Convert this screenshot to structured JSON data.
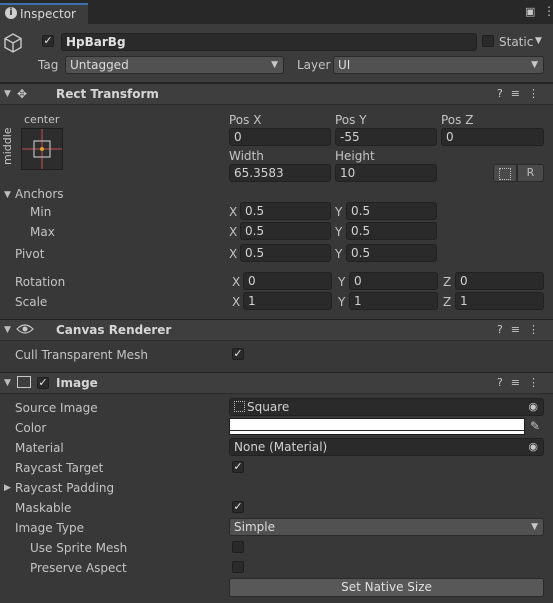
{
  "tab": {
    "title": "Inspector"
  },
  "object": {
    "name": "HpBarBg",
    "static_label": "Static",
    "tag_label": "Tag",
    "tag_value": "Untagged",
    "layer_label": "Layer",
    "layer_value": "UI"
  },
  "rect_transform": {
    "title": "Rect Transform",
    "anchor_preset_top": "center",
    "anchor_preset_side": "middle",
    "posx_label": "Pos X",
    "posy_label": "Pos Y",
    "posz_label": "Pos Z",
    "posx": "0",
    "posy": "-55",
    "posz": "0",
    "width_label": "Width",
    "height_label": "Height",
    "width": "65.3583",
    "height": "10",
    "r_button": "R",
    "anchors_label": "Anchors",
    "min_label": "Min",
    "max_label": "Max",
    "min_x": "0.5",
    "min_y": "0.5",
    "max_x": "0.5",
    "max_y": "0.5",
    "pivot_label": "Pivot",
    "pivot_x": "0.5",
    "pivot_y": "0.5",
    "rotation_label": "Rotation",
    "rot_x": "0",
    "rot_y": "0",
    "rot_z": "0",
    "scale_label": "Scale",
    "scale_x": "1",
    "scale_y": "1",
    "scale_z": "1",
    "x": "X",
    "y": "Y",
    "z": "Z"
  },
  "canvas_renderer": {
    "title": "Canvas Renderer",
    "cull_label": "Cull Transparent Mesh"
  },
  "image": {
    "title": "Image",
    "source_label": "Source Image",
    "source_value": "Square",
    "color_label": "Color",
    "material_label": "Material",
    "material_value": "None (Material)",
    "raycast_target_label": "Raycast Target",
    "raycast_padding_label": "Raycast Padding",
    "maskable_label": "Maskable",
    "image_type_label": "Image Type",
    "image_type_value": "Simple",
    "use_sprite_mesh_label": "Use Sprite Mesh",
    "preserve_aspect_label": "Preserve Aspect",
    "native_size_button": "Set Native Size"
  }
}
